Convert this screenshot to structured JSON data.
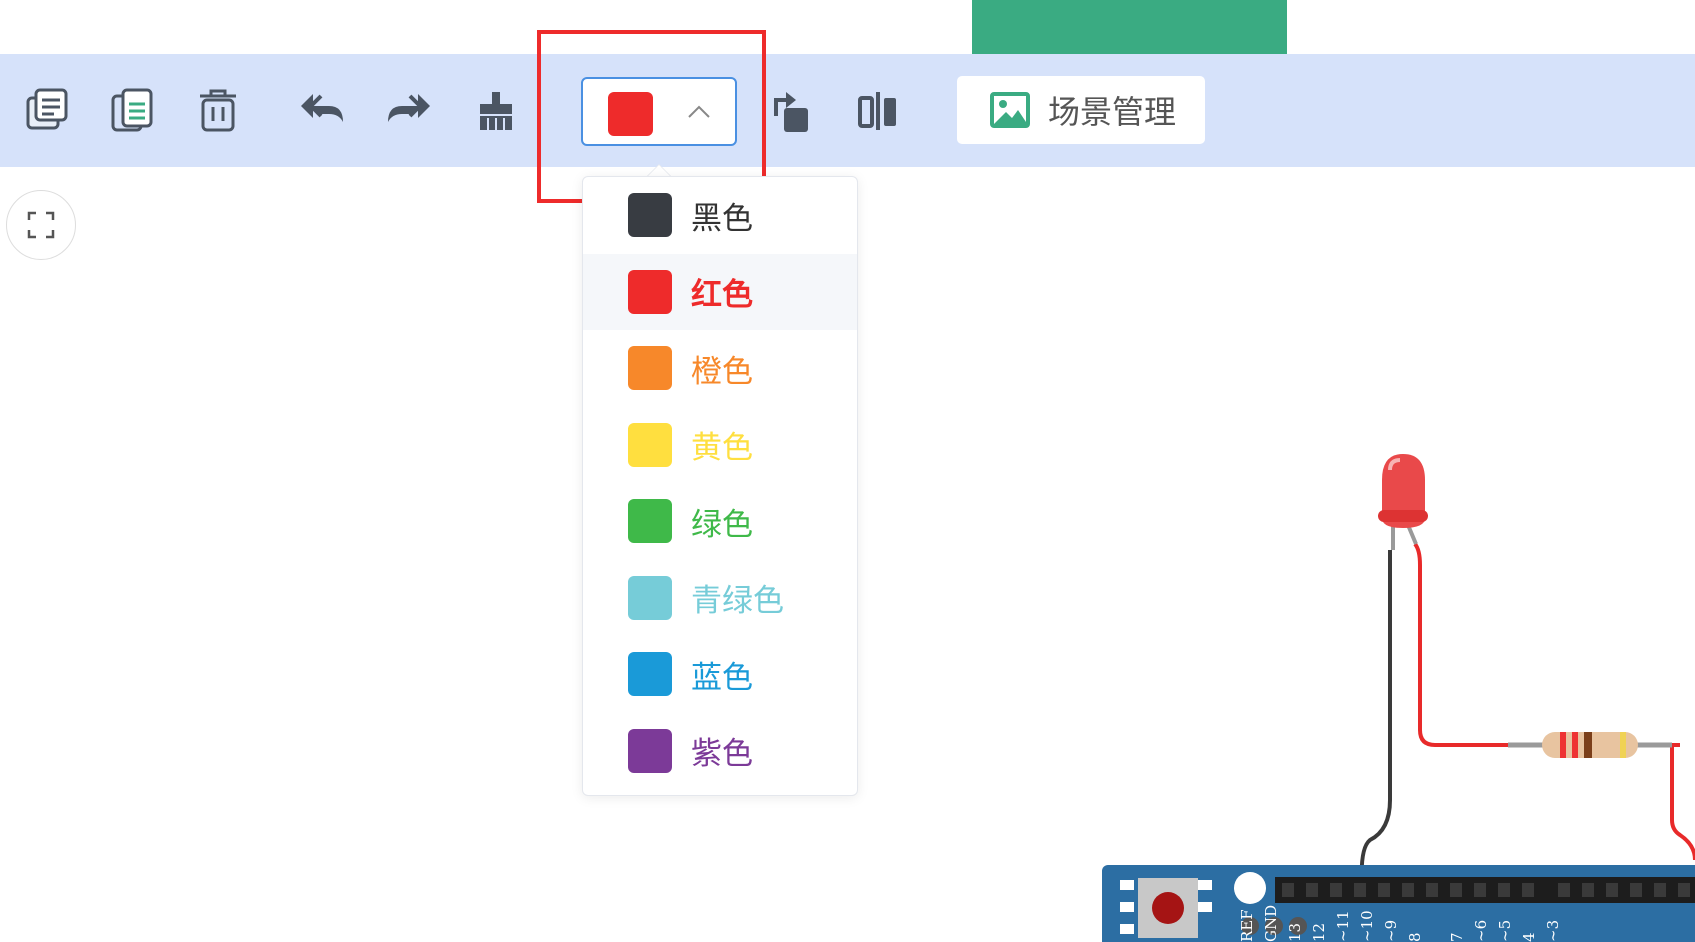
{
  "toolbar": {
    "tools": [
      {
        "name": "copy-icon"
      },
      {
        "name": "paste-icon"
      },
      {
        "name": "delete-icon"
      },
      {
        "name": "undo-icon"
      },
      {
        "name": "redo-icon"
      },
      {
        "name": "clean-brush-icon"
      },
      {
        "name": "rotate-icon"
      },
      {
        "name": "flip-icon"
      }
    ],
    "color_select": {
      "selected_color": "#ee2b2b",
      "expanded": true
    },
    "scene_button": {
      "label": "场景管理",
      "icon": "image-icon"
    }
  },
  "colors": {
    "toolbar_bg": "#d6e2fa",
    "accent_green": "#3aab82",
    "highlight": "#ee2b2b"
  },
  "dropdown": {
    "items": [
      {
        "label": "黑色",
        "color": "#383c42",
        "text_color": "#333333"
      },
      {
        "label": "红色",
        "color": "#ee2b2b",
        "text_color": "#ee2b2b",
        "selected": true
      },
      {
        "label": "橙色",
        "color": "#f7882a",
        "text_color": "#f7882a"
      },
      {
        "label": "黄色",
        "color": "#ffdf3f",
        "text_color": "#ffdf3f"
      },
      {
        "label": "绿色",
        "color": "#3fb949",
        "text_color": "#3fb949"
      },
      {
        "label": "青绿色",
        "color": "#76ccd8",
        "text_color": "#76ccd8"
      },
      {
        "label": "蓝色",
        "color": "#1a9ad8",
        "text_color": "#1a9ad8"
      },
      {
        "label": "紫色",
        "color": "#7c3a98",
        "text_color": "#7c3a98"
      }
    ]
  },
  "board": {
    "pin_labels": [
      "REF",
      "GND",
      "13",
      "12",
      "~11",
      "~10",
      "~9",
      "8",
      "7",
      "~6",
      "~5",
      "4",
      "~3"
    ]
  }
}
